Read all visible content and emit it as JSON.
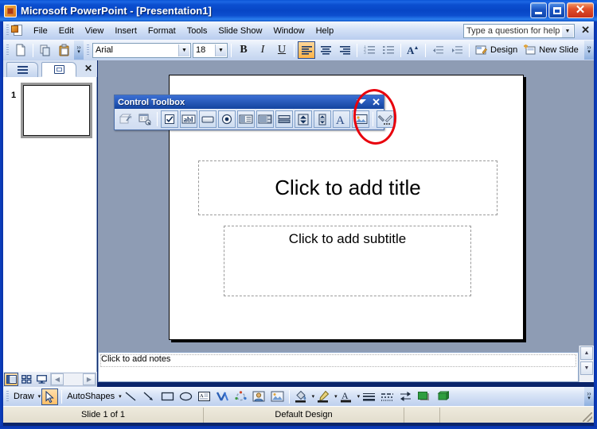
{
  "window": {
    "title": "Microsoft PowerPoint - [Presentation1]",
    "app_icon": "powerpoint-icon",
    "minimize_label": "",
    "maximize_label": "",
    "close_label": "✕"
  },
  "menubar": {
    "doc_icon": "document-icon",
    "items": [
      {
        "label": "File",
        "mnemonic": "F"
      },
      {
        "label": "Edit",
        "mnemonic": "E"
      },
      {
        "label": "View",
        "mnemonic": "V"
      },
      {
        "label": "Insert",
        "mnemonic": "I"
      },
      {
        "label": "Format",
        "mnemonic": "o"
      },
      {
        "label": "Tools",
        "mnemonic": "T"
      },
      {
        "label": "Slide Show",
        "mnemonic": "S"
      },
      {
        "label": "Window",
        "mnemonic": "W"
      },
      {
        "label": "Help",
        "mnemonic": "H"
      }
    ],
    "ask_a_question": "Type a question for help",
    "close_label": "✕"
  },
  "toolbar": {
    "new_tip": "new-document",
    "copy_tip": "copy",
    "paste_tip": "paste",
    "font_name": "Arial",
    "font_size": "18",
    "bold_label": "B",
    "italic_label": "I",
    "underline_label": "U",
    "align_left_tip": "align-left",
    "align_center_tip": "align-center",
    "align_right_tip": "align-right",
    "numbering_tip": "numbered-list",
    "bullets_tip": "bulleted-list",
    "font_size_up_label": "A",
    "decrease_indent_tip": "decrease-indent",
    "increase_indent_tip": "increase-indent",
    "design_label": "Design",
    "new_slide_label": "New Slide",
    "overflow_label": "»"
  },
  "left_panel": {
    "tab_outline": "outline-tab",
    "tab_slides": "slides-tab",
    "close_label": "✕",
    "slides": [
      {
        "number": "1"
      }
    ]
  },
  "slide": {
    "title_placeholder": "Click to add title",
    "subtitle_placeholder": "Click to add subtitle"
  },
  "control_toolbox": {
    "title": "Control Toolbox",
    "close_label": "✕",
    "buttons": [
      {
        "name": "design-mode-icon",
        "tip": "Design Mode"
      },
      {
        "name": "properties-icon",
        "tip": "Properties"
      },
      {
        "name": "check-box-icon",
        "tip": "Check Box"
      },
      {
        "name": "text-box-icon",
        "tip": "Text Box"
      },
      {
        "name": "command-button-icon",
        "tip": "Command Button"
      },
      {
        "name": "option-button-icon",
        "tip": "Option Button"
      },
      {
        "name": "list-box-icon",
        "tip": "List Box"
      },
      {
        "name": "combo-box-icon",
        "tip": "Combo Box"
      },
      {
        "name": "toggle-button-icon",
        "tip": "Toggle Button"
      },
      {
        "name": "spin-button-icon",
        "tip": "Spin Button"
      },
      {
        "name": "scroll-bar-icon",
        "tip": "Scroll Bar"
      },
      {
        "name": "label-icon",
        "tip": "Label"
      },
      {
        "name": "image-icon",
        "tip": "Image"
      },
      {
        "name": "more-controls-icon",
        "tip": "More Controls"
      }
    ],
    "highlighted_button": "more-controls-icon"
  },
  "annotation": {
    "shape": "ellipse",
    "color": "#e8000c",
    "target": "more-controls-icon"
  },
  "notes_pane": {
    "placeholder": "Click to add notes"
  },
  "view_buttons": [
    {
      "name": "normal-view-button",
      "active": true
    },
    {
      "name": "slide-sorter-view-button",
      "active": false
    },
    {
      "name": "slide-show-view-button",
      "active": false
    }
  ],
  "drawing_toolbar": {
    "draw_label": "Draw",
    "select_tip": "select-objects",
    "autoshapes_label": "AutoShapes",
    "line_tip": "line",
    "arrow_tip": "arrow",
    "rectangle_tip": "rectangle",
    "oval_tip": "oval",
    "textbox_tip": "text-box",
    "wordart_tip": "insert-wordart",
    "diagram_tip": "insert-diagram",
    "clipart_tip": "insert-clip-art",
    "picture_tip": "insert-picture",
    "fill_color_tip": "fill-color",
    "line_color_tip": "line-color",
    "font_color_label": "A",
    "line_style_tip": "line-style",
    "dash_style_tip": "dash-style",
    "arrow_style_tip": "arrow-style",
    "shadow_style_tip": "shadow-style",
    "three_d_style_tip": "3-d-style",
    "dropdown_label": "▾",
    "overflow_label": "»"
  },
  "statusbar": {
    "slide_counter": "Slide 1 of 1",
    "design_name": "Default Design",
    "language": "",
    "extra": ""
  },
  "colors": {
    "titlebar_blue": "#0a4fc9",
    "workarea_gray": "#8e9cb4",
    "toolbar_blue": "#dbe6f7",
    "annotation_red": "#e8000c",
    "statusbar_tan": "#e8e3d4",
    "accent_orange": "#ffbe66"
  }
}
